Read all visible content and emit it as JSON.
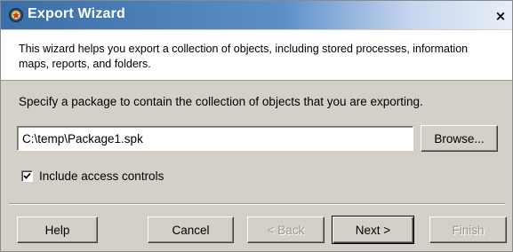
{
  "window": {
    "title": "Export Wizard",
    "close_glyph": "×",
    "icon": "wizard-app-icon"
  },
  "intro": {
    "text": "This wizard helps you export a collection of objects, including stored processes, information maps, reports, and folders."
  },
  "package": {
    "instruction": "Specify a package to contain the collection of objects that you are exporting.",
    "path_value": "C:\\temp\\Package1.spk",
    "browse_label": "Browse..."
  },
  "options": {
    "include_access_controls_label": "Include access controls",
    "include_access_controls_checked": true
  },
  "buttons": {
    "help": "Help",
    "cancel": "Cancel",
    "back": "< Back",
    "next": "Next >",
    "finish": "Finish"
  }
}
